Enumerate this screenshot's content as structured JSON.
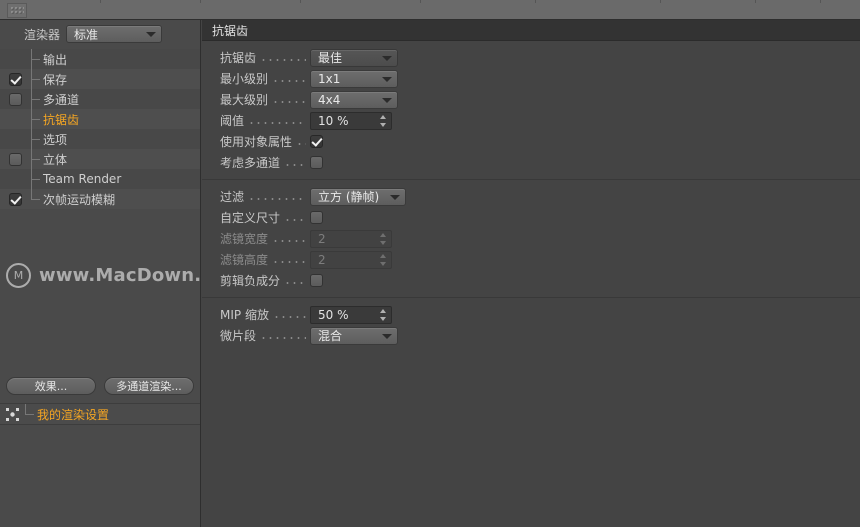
{
  "window": {
    "toolbar_grip": "grip-handle"
  },
  "sidebar": {
    "renderer_label": "渲染器",
    "renderer_value": "标准",
    "items": [
      {
        "label": "输出",
        "checkbox": "none",
        "checked": false
      },
      {
        "label": "保存",
        "checkbox": "checked",
        "checked": true
      },
      {
        "label": "多通道",
        "checkbox": "unchecked",
        "checked": false
      },
      {
        "label": "抗锯齿",
        "checkbox": "none",
        "checked": false,
        "selected": true
      },
      {
        "label": "选项",
        "checkbox": "none",
        "checked": false
      },
      {
        "label": "立体",
        "checkbox": "unchecked",
        "checked": false
      },
      {
        "label": "Team Render",
        "checkbox": "none",
        "checked": false
      },
      {
        "label": "次帧运动模糊",
        "checkbox": "checked",
        "checked": true
      }
    ],
    "buttons": {
      "effects": "效果...",
      "multipass": "多通道渲染..."
    },
    "preset": {
      "label": "我的渲染设置",
      "icon": "axis-move-icon"
    }
  },
  "watermark": {
    "logo": "M",
    "text": "www.MacDown.com"
  },
  "panel": {
    "title": "抗锯齿",
    "groups": [
      {
        "rows": [
          {
            "label": "抗锯齿",
            "type": "dropdown",
            "value": "最佳",
            "style": "flat",
            "disabled": false
          },
          {
            "label": "最小级别",
            "type": "dropdown",
            "value": "1x1",
            "style": "raised",
            "disabled": false
          },
          {
            "label": "最大级别",
            "type": "dropdown",
            "value": "4x4",
            "style": "raised",
            "disabled": false
          },
          {
            "label": "阈值",
            "type": "number",
            "value": "10 %",
            "disabled": false
          },
          {
            "label": "使用对象属性",
            "type": "checkbox",
            "value": "checked",
            "disabled": false
          },
          {
            "label": "考虑多通道",
            "type": "checkbox",
            "value": "unchecked",
            "disabled": false
          }
        ]
      },
      {
        "rows": [
          {
            "label": "过滤",
            "type": "dropdown",
            "value": "立方 (静帧)",
            "style": "raised",
            "disabled": false
          },
          {
            "label": "自定义尺寸",
            "type": "checkbox",
            "value": "unchecked",
            "disabled": false
          },
          {
            "label": "滤镜宽度",
            "type": "number",
            "value": "2",
            "disabled": true
          },
          {
            "label": "滤镜高度",
            "type": "number",
            "value": "2",
            "disabled": true
          },
          {
            "label": "剪辑负成分",
            "type": "checkbox",
            "value": "unchecked",
            "disabled": false
          }
        ]
      },
      {
        "rows": [
          {
            "label": "MIP 缩放",
            "type": "number",
            "value": "50 %",
            "disabled": false
          },
          {
            "label": "微片段",
            "type": "dropdown",
            "value": "混合",
            "style": "raised",
            "disabled": false
          }
        ]
      }
    ]
  },
  "colors": {
    "accent": "#f5a623",
    "panel_bg": "#444444",
    "sidebar_bg": "#4a4a4a",
    "header_bg": "#333333",
    "toolbar_bg": "#6a6a6a"
  }
}
